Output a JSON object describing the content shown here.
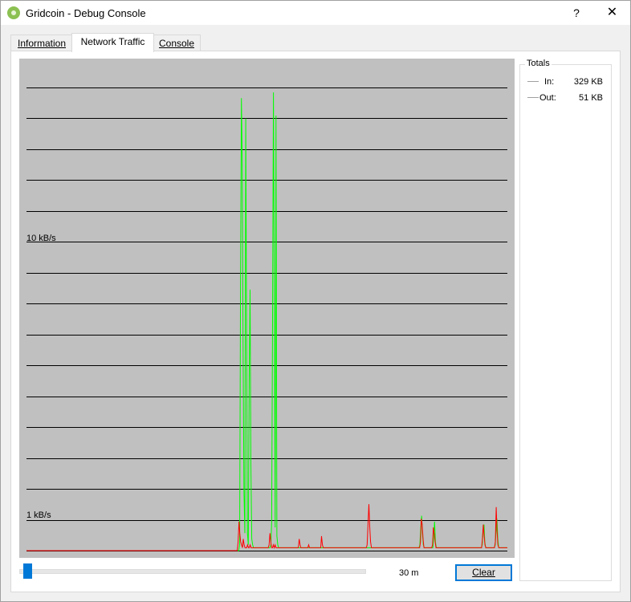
{
  "window": {
    "title": "Gridcoin - Debug Console",
    "help_glyph": "?",
    "close_glyph": "✕"
  },
  "tabs": [
    {
      "label": "Information",
      "active": false
    },
    {
      "label": "Network Traffic",
      "active": true
    },
    {
      "label": "Console",
      "active": false
    }
  ],
  "graph": {
    "label_high": "10 kB/s",
    "label_low": "1 kB/s",
    "colors": {
      "in": "#00ff00",
      "out": "#ff0000",
      "background": "#c0c0c0"
    }
  },
  "chart_data": {
    "type": "line",
    "title": "",
    "xlabel": "",
    "ylabel": "",
    "y_tick_labels": [
      "10 kB/s",
      "1 kB/s"
    ],
    "grid": true,
    "series": [
      {
        "name": "In",
        "values": [
          0,
          0,
          0,
          0,
          0,
          0,
          0,
          0,
          0,
          0,
          0,
          0,
          0,
          0,
          0,
          0,
          0,
          0,
          0,
          0,
          0,
          0,
          0,
          0,
          0,
          0,
          0,
          0,
          0,
          0,
          0,
          0,
          0,
          0,
          0,
          0,
          0,
          0,
          0,
          0,
          0,
          0,
          0,
          0,
          0,
          0,
          0,
          0,
          0,
          0,
          0,
          0,
          0,
          0,
          0,
          0,
          0,
          0,
          0,
          0,
          0,
          0,
          0,
          0,
          0,
          0,
          0,
          0,
          0,
          0,
          0,
          0,
          0,
          0,
          0,
          0,
          0,
          0,
          0,
          0,
          0,
          0,
          0,
          0,
          0,
          0,
          0,
          0,
          0,
          0,
          0,
          0,
          0,
          0,
          0,
          0,
          0,
          0,
          0,
          0,
          0,
          0,
          0,
          0,
          0,
          0,
          0,
          0,
          0,
          0,
          0,
          0,
          0,
          0,
          0,
          0,
          0,
          0,
          0,
          0,
          0,
          0,
          0,
          0,
          0,
          0,
          0,
          0,
          0,
          0,
          0,
          0,
          0,
          0,
          0,
          0,
          0,
          0,
          0,
          0,
          0,
          0,
          0,
          0,
          0,
          0,
          0,
          0,
          0,
          0,
          0,
          0,
          0,
          0,
          0,
          0,
          0,
          0,
          0,
          0,
          0,
          0,
          0,
          0,
          0,
          0,
          0,
          0,
          0,
          0,
          0,
          0,
          0,
          0,
          0,
          0,
          0,
          0,
          0,
          0,
          0,
          0,
          0,
          0,
          0,
          0,
          0,
          0,
          0,
          0,
          0,
          0,
          0,
          0,
          0,
          0,
          0,
          0,
          0,
          0,
          0,
          0,
          0,
          0,
          0,
          0,
          0,
          0,
          0,
          0,
          0,
          0,
          0,
          0,
          0,
          0,
          0,
          0,
          0,
          0,
          0,
          0,
          0,
          0,
          0,
          0,
          0,
          0,
          0,
          0,
          0,
          0,
          0,
          0,
          0,
          0,
          0,
          0,
          0,
          0,
          0,
          0,
          0,
          0,
          0,
          0,
          0.2,
          9.0,
          15.6,
          13.5,
          7.0,
          2.0,
          0.6,
          14.9,
          8.0,
          0.6,
          0.2,
          6.0,
          9.0,
          3.0,
          0.4,
          0.2,
          0.1,
          0.1,
          0.1,
          0.1,
          0.1,
          0.1,
          0.1,
          0.1,
          0.1,
          0.1,
          0.1,
          0.1,
          0.1,
          0.1,
          0.1,
          0.1,
          0.1,
          0.1,
          0.1,
          0.1,
          0.2,
          1.0,
          8.0,
          15.8,
          9.0,
          0.8,
          15.0,
          0.5,
          0.2,
          0.1,
          0.1,
          0.1,
          0.1,
          0.1,
          0.1,
          0.1,
          0.1,
          0.1,
          0.1,
          0.1,
          0.1,
          0.1,
          0.1,
          0.1,
          0.1,
          0.1,
          0.1,
          0.1,
          0.1,
          0.1,
          0.1,
          0.1,
          0.1,
          0.1,
          0.1,
          0.1,
          0.1,
          0.1,
          0.1,
          0.1,
          0.1,
          0.1,
          0.1,
          0.1,
          0.1,
          0.1,
          0.1,
          0.1,
          0.1,
          0.1,
          0.1,
          0.1,
          0.1,
          0.1,
          0.1,
          0.1,
          0.1,
          0.1,
          0.1,
          0.1,
          0.1,
          0.1,
          0.1,
          0.1,
          0.1,
          0.1,
          0.1,
          0.1,
          0.1,
          0.1,
          0.1,
          0.1,
          0.1,
          0.1,
          0.1,
          0.1,
          0.1,
          0.1,
          0.1,
          0.1,
          0.1,
          0.1,
          0.1,
          0.1,
          0.1,
          0.1,
          0.1,
          0.1,
          0.1,
          0.1,
          0.1,
          0.1,
          0.1,
          0.1,
          0.1,
          0.1,
          0.1,
          0.1,
          0.1,
          0.1,
          0.1,
          0.1,
          0.1,
          0.1,
          0.1,
          0.1,
          0.1,
          0.1,
          0.1,
          0.1,
          0.1,
          0.1,
          0.1,
          0.1,
          0.1,
          0.1,
          0.1,
          0.1,
          0.1,
          0.1,
          0.1,
          0.1,
          0.1,
          0.1,
          0.1,
          0.1,
          0.1,
          0.1,
          0.1,
          0.1,
          0.1,
          0.1,
          0.1,
          0.1,
          0.1,
          0.1,
          0.1,
          0.1,
          0.1,
          0.1,
          0.1,
          0.1,
          0.1,
          0.1,
          0.1,
          0.1,
          0.1,
          0.1,
          0.1,
          0.1,
          0.1,
          0.1,
          0.1,
          0.1,
          0.1,
          0.1,
          0.1,
          0.1,
          0.1,
          0.1,
          0.1,
          0.1,
          0.1,
          0.1,
          0.1,
          0.1,
          0.1,
          0.1,
          0.1,
          0.1,
          0.1,
          0.1,
          0.2,
          0.8,
          1.2,
          0.6,
          0.2,
          0.1,
          0.1,
          0.1,
          0.1,
          0.1,
          0.1,
          0.1,
          0.1,
          0.1,
          0.1,
          0.1,
          0.5,
          1.0,
          0.3,
          0.1,
          0.1,
          0.1,
          0.1,
          0.1,
          0.1,
          0.1,
          0.1,
          0.1,
          0.1,
          0.1,
          0.1,
          0.1,
          0.1,
          0.1,
          0.1,
          0.1,
          0.1,
          0.1,
          0.1,
          0.1,
          0.1,
          0.1,
          0.1,
          0.1,
          0.1,
          0.1,
          0.1,
          0.1,
          0.1,
          0.1,
          0.1,
          0.1,
          0.1,
          0.1,
          0.1,
          0.1,
          0.1,
          0.1,
          0.1,
          0.1,
          0.1,
          0.1,
          0.1,
          0.1,
          0.1,
          0.1,
          0.1,
          0.1,
          0.1,
          0.1,
          0.1,
          0.1,
          0.2,
          0.7,
          0.9,
          0.3,
          0.1,
          0.1,
          0.1,
          0.1,
          0.1,
          0.1,
          0.1,
          0.1,
          0.1,
          0.1,
          0.1,
          0.2,
          0.7,
          1.1,
          0.4,
          0.1,
          0.1,
          0.1,
          0.1,
          0.1,
          0.1,
          0.1,
          0.1,
          0.1,
          0.1,
          0.1
        ]
      },
      {
        "name": "Out",
        "values": [
          0,
          0,
          0,
          0,
          0,
          0,
          0,
          0,
          0,
          0,
          0,
          0,
          0,
          0,
          0,
          0,
          0,
          0,
          0,
          0,
          0,
          0,
          0,
          0,
          0,
          0,
          0,
          0,
          0,
          0,
          0,
          0,
          0,
          0,
          0,
          0,
          0,
          0,
          0,
          0,
          0,
          0,
          0,
          0,
          0,
          0,
          0,
          0,
          0,
          0,
          0,
          0,
          0,
          0,
          0,
          0,
          0,
          0,
          0,
          0,
          0,
          0,
          0,
          0,
          0,
          0,
          0,
          0,
          0,
          0,
          0,
          0,
          0,
          0,
          0,
          0,
          0,
          0,
          0,
          0,
          0,
          0,
          0,
          0,
          0,
          0,
          0,
          0,
          0,
          0,
          0,
          0,
          0,
          0,
          0,
          0,
          0,
          0,
          0,
          0,
          0,
          0,
          0,
          0,
          0,
          0,
          0,
          0,
          0,
          0,
          0,
          0,
          0,
          0,
          0,
          0,
          0,
          0,
          0,
          0,
          0,
          0,
          0,
          0,
          0,
          0,
          0,
          0,
          0,
          0,
          0,
          0,
          0,
          0,
          0,
          0,
          0,
          0,
          0,
          0,
          0,
          0,
          0,
          0,
          0,
          0,
          0,
          0,
          0,
          0,
          0,
          0,
          0,
          0,
          0,
          0,
          0,
          0,
          0,
          0,
          0,
          0,
          0,
          0,
          0,
          0,
          0,
          0,
          0,
          0,
          0,
          0,
          0,
          0,
          0,
          0,
          0,
          0,
          0,
          0,
          0,
          0,
          0,
          0,
          0,
          0,
          0,
          0,
          0,
          0,
          0,
          0,
          0,
          0,
          0,
          0,
          0,
          0,
          0,
          0,
          0,
          0,
          0,
          0,
          0,
          0,
          0,
          0,
          0,
          0,
          0,
          0,
          0,
          0,
          0,
          0,
          0,
          0,
          0,
          0,
          0,
          0,
          0,
          0,
          0,
          0,
          0,
          0,
          0,
          0,
          0,
          0,
          0,
          0,
          0,
          0,
          0,
          0,
          0,
          0,
          0,
          0,
          0,
          0,
          0,
          0,
          0.3,
          1.0,
          0.6,
          0.3,
          0.2,
          0.1,
          0.4,
          0.2,
          0.1,
          0.1,
          0.1,
          0.2,
          0.1,
          0.1,
          0.2,
          0.1,
          0.1,
          0.1,
          0.1,
          0.1,
          0.1,
          0.1,
          0.1,
          0.1,
          0.1,
          0.1,
          0.1,
          0.1,
          0.1,
          0.1,
          0.1,
          0.1,
          0.1,
          0.1,
          0.1,
          0.1,
          0.2,
          0.6,
          0.3,
          0.1,
          0.1,
          0.2,
          0.1,
          0.2,
          0.1,
          0.1,
          0.1,
          0.1,
          0.1,
          0.1,
          0.1,
          0.1,
          0.1,
          0.1,
          0.1,
          0.1,
          0.1,
          0.1,
          0.1,
          0.1,
          0.1,
          0.1,
          0.1,
          0.1,
          0.1,
          0.1,
          0.1,
          0.1,
          0.1,
          0.1,
          0.1,
          0.4,
          0.2,
          0.1,
          0.1,
          0.1,
          0.1,
          0.1,
          0.1,
          0.1,
          0.1,
          0.1,
          0.2,
          0.1,
          0.1,
          0.1,
          0.1,
          0.1,
          0.1,
          0.1,
          0.1,
          0.1,
          0.1,
          0.1,
          0.1,
          0.1,
          0.1,
          0.5,
          0.2,
          0.1,
          0.1,
          0.1,
          0.1,
          0.1,
          0.1,
          0.1,
          0.1,
          0.1,
          0.1,
          0.1,
          0.1,
          0.1,
          0.1,
          0.1,
          0.1,
          0.1,
          0.1,
          0.1,
          0.1,
          0.1,
          0.1,
          0.1,
          0.1,
          0.1,
          0.1,
          0.1,
          0.1,
          0.1,
          0.1,
          0.1,
          0.1,
          0.1,
          0.1,
          0.1,
          0.1,
          0.1,
          0.1,
          0.1,
          0.1,
          0.1,
          0.1,
          0.1,
          0.1,
          0.1,
          0.1,
          0.1,
          0.1,
          0.1,
          0.1,
          0.1,
          0.2,
          0.9,
          1.6,
          0.8,
          0.3,
          0.1,
          0.1,
          0.1,
          0.1,
          0.1,
          0.1,
          0.1,
          0.1,
          0.1,
          0.1,
          0.1,
          0.1,
          0.1,
          0.1,
          0.1,
          0.1,
          0.1,
          0.1,
          0.1,
          0.1,
          0.1,
          0.1,
          0.1,
          0.1,
          0.1,
          0.1,
          0.1,
          0.1,
          0.1,
          0.1,
          0.1,
          0.1,
          0.1,
          0.1,
          0.1,
          0.1,
          0.1,
          0.1,
          0.1,
          0.1,
          0.1,
          0.1,
          0.1,
          0.1,
          0.1,
          0.1,
          0.1,
          0.1,
          0.1,
          0.1,
          0.1,
          0.1,
          0.1,
          0.1,
          0.1,
          0.1,
          0.1,
          0.3,
          1.1,
          0.9,
          0.4,
          0.1,
          0.1,
          0.1,
          0.1,
          0.1,
          0.1,
          0.1,
          0.1,
          0.1,
          0.1,
          0.2,
          0.8,
          0.6,
          0.3,
          0.1,
          0.1,
          0.1,
          0.1,
          0.1,
          0.1,
          0.1,
          0.1,
          0.1,
          0.1,
          0.1,
          0.1,
          0.1,
          0.1,
          0.1,
          0.1,
          0.1,
          0.1,
          0.1,
          0.1,
          0.1,
          0.1,
          0.1,
          0.1,
          0.1,
          0.1,
          0.1,
          0.1,
          0.1,
          0.1,
          0.1,
          0.1,
          0.1,
          0.1,
          0.1,
          0.1,
          0.1,
          0.1,
          0.1,
          0.1,
          0.1,
          0.1,
          0.1,
          0.1,
          0.1,
          0.1,
          0.1,
          0.1,
          0.1,
          0.1,
          0.1,
          0.1,
          0.1,
          0.1,
          0.4,
          0.9,
          0.5,
          0.2,
          0.1,
          0.1,
          0.1,
          0.1,
          0.1,
          0.1,
          0.1,
          0.1,
          0.1,
          0.1,
          0.1,
          0.3,
          1.5,
          0.7,
          0.2,
          0.1,
          0.1,
          0.1,
          0.1,
          0.1,
          0.1,
          0.1,
          0.1,
          0.1,
          0.1,
          0.1
        ]
      }
    ]
  },
  "controls": {
    "range_label": "30 m",
    "slider_value": 0,
    "clear_label": "Clear"
  },
  "totals": {
    "title": "Totals",
    "in_label": "In:",
    "in_value": "329 KB",
    "out_label": "Out:",
    "out_value": "51 KB"
  }
}
